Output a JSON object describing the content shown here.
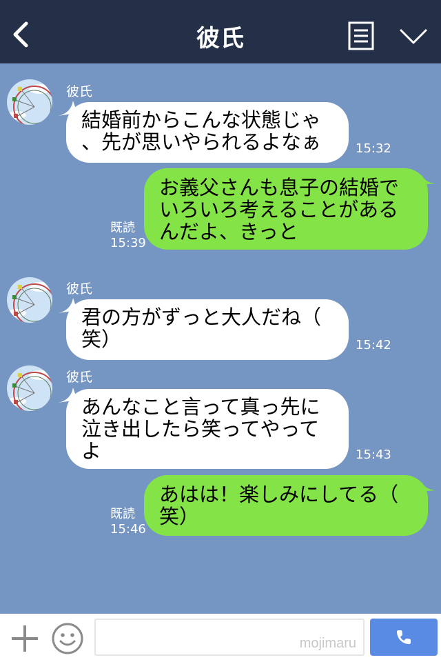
{
  "header": {
    "title": "彼氏",
    "back_icon": "chevron-left-icon",
    "menu_icon": "menu-icon",
    "collapse_icon": "chevron-down-icon"
  },
  "messages": [
    {
      "side": "left",
      "sender": "彼氏",
      "text": "結婚前からこんな状態じゃ\n、先が思いやられるよなぁ",
      "time": "15:32"
    },
    {
      "side": "right",
      "text": "お義父さんも息子の結婚で\nいろいろ考えることがある\nんだよ、きっと",
      "read": "既読",
      "time": "15:39"
    },
    {
      "side": "left",
      "sender": "彼氏",
      "text": "君の方がずっと大人だね（\n笑）",
      "time": "15:42"
    },
    {
      "side": "left",
      "sender": "彼氏",
      "text": "あんなこと言って真っ先に\n泣き出したら笑ってやって\nよ",
      "time": "15:43"
    },
    {
      "side": "right",
      "text": "あはは！楽しみにしてる（\n笑）",
      "read": "既読",
      "time": "15:46"
    }
  ],
  "footer": {
    "plus_icon": "plus-icon",
    "emoji_icon": "smiley-icon",
    "watermark": "mojimaru",
    "call_icon": "phone-icon"
  },
  "colors": {
    "header_bg": "#243047",
    "chat_bg": "#7595c3",
    "bubble_left": "#ffffff",
    "bubble_right": "#84e347",
    "call_button": "#5a8be4"
  }
}
